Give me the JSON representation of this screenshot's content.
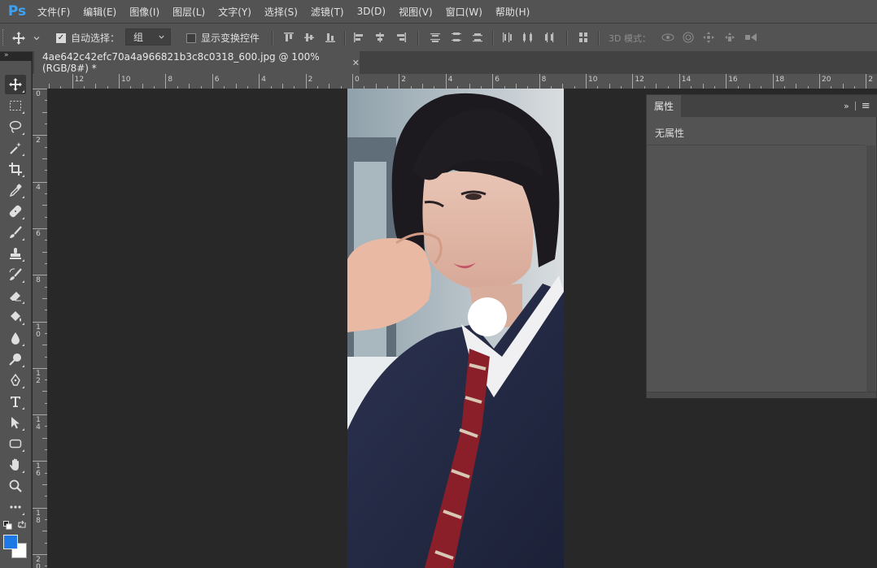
{
  "app": {
    "logo": "Ps",
    "menu": [
      "文件(F)",
      "编辑(E)",
      "图像(I)",
      "图层(L)",
      "文字(Y)",
      "选择(S)",
      "滤镜(T)",
      "3D(D)",
      "视图(V)",
      "窗口(W)",
      "帮助(H)"
    ]
  },
  "options": {
    "auto_select_label": "自动选择：",
    "auto_select_checked": true,
    "auto_select_target": "组",
    "show_transform_label": "显示变换控件",
    "show_transform_checked": false,
    "mode_3d_label": "3D 模式："
  },
  "collapse_glyph": "»",
  "document": {
    "tab_title": "4ae642c42efc70a4a966821b3c8c0318_600.jpg @ 100%(RGB/8#) *",
    "close_glyph": "✕"
  },
  "ruler": {
    "h_labels": [
      "12",
      "10",
      "8",
      "6",
      "4",
      "2",
      "0",
      "2",
      "4",
      "6",
      "8",
      "10",
      "12",
      "14",
      "16",
      "18",
      "20",
      "2"
    ],
    "v_labels": [
      "0",
      "2",
      "4",
      "6",
      "8",
      "10",
      "12",
      "14",
      "16",
      "18",
      "20"
    ]
  },
  "properties_panel": {
    "tab_label": "属性",
    "collapse_glyph": "»",
    "menu_glyph": "≡",
    "empty_text": "无属性"
  },
  "colors": {
    "foreground": "#1e78e6",
    "background": "#ffffff",
    "chrome": "#535353",
    "canvas": "#282828"
  },
  "tools": [
    "move-icon",
    "marquee-icon",
    "lasso-icon",
    "magic-wand-icon",
    "crop-icon",
    "eyedropper-icon",
    "healing-brush-icon",
    "brush-icon",
    "clone-stamp-icon",
    "history-brush-icon",
    "eraser-icon",
    "paint-bucket-icon",
    "blur-icon",
    "dodge-icon",
    "pen-icon",
    "type-icon",
    "path-selection-icon",
    "rectangle-icon",
    "hand-icon",
    "zoom-icon",
    "more-tools-icon"
  ]
}
